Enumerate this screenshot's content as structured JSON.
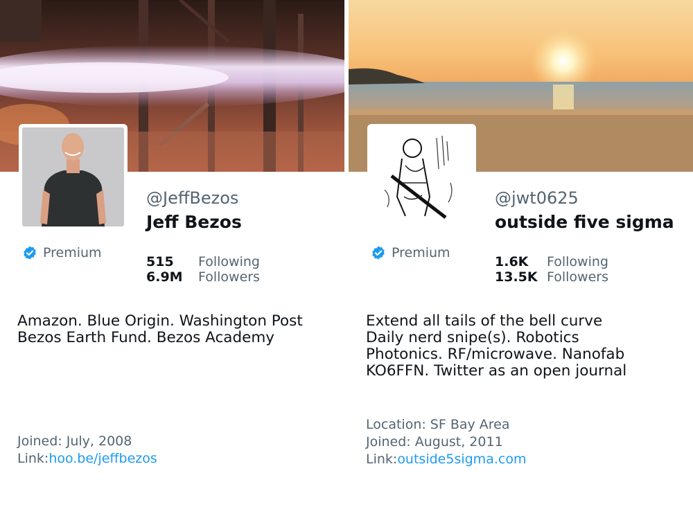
{
  "profiles": [
    {
      "handle": "@JeffBezos",
      "name": "Jeff Bezos",
      "badge": "Premium",
      "following_count": "515",
      "following_label": "Following",
      "followers_count": "6.9M",
      "followers_label": "Followers",
      "bio": [
        "Amazon. Blue Origin. Washington Post",
        "Bezos Earth Fund. Bezos Academy"
      ],
      "location": null,
      "joined": "Joined: July, 2008",
      "link_label": "Link:",
      "link_url": "hoo.be/jeffbezos"
    },
    {
      "handle": "@jwt0625",
      "name": "outside five sigma",
      "badge": "Premium",
      "following_count": "1.6K",
      "following_label": "Following",
      "followers_count": "13.5K",
      "followers_label": "Followers",
      "bio": [
        "Extend all tails of the bell curve",
        "Daily nerd snipe(s). Robotics",
        "Photonics. RF/microwave. Nanofab",
        "KO6FFN. Twitter as an open journal"
      ],
      "location": "Location: SF Bay Area",
      "joined": "Joined: August, 2011",
      "link_label": "Link:",
      "link_url": "outside5sigma.com"
    }
  ],
  "colors": {
    "text_primary": "#0f1419",
    "text_secondary": "#536471",
    "link": "#1d9bf0",
    "verified_badge": "#1d9bf0"
  },
  "icons": {
    "verified": "verified-badge-icon"
  }
}
